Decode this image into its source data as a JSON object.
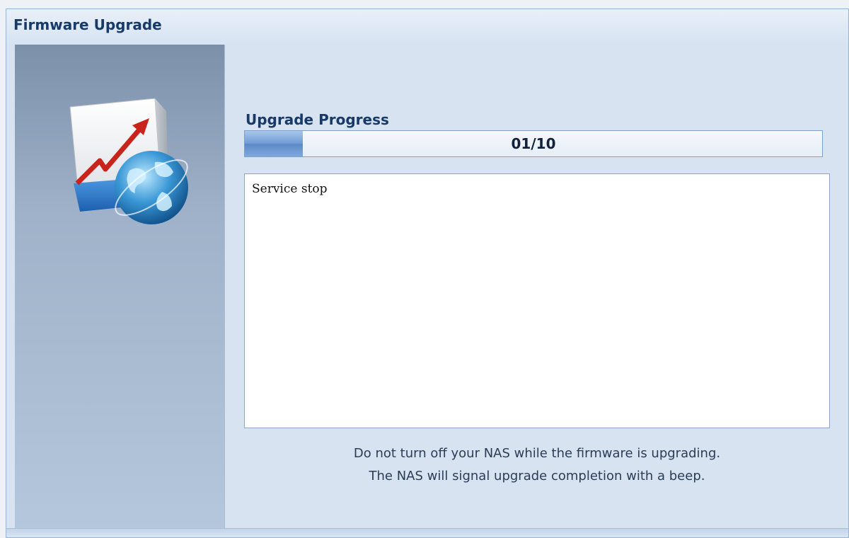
{
  "window": {
    "title": "Firmware Upgrade"
  },
  "progress": {
    "label": "Upgrade Progress",
    "text": "01/10",
    "fraction": 0.1
  },
  "log": {
    "lines": [
      "Service stop"
    ]
  },
  "notice": {
    "line1": "Do not turn off your NAS while the firmware is upgrading.",
    "line2": "The NAS will signal upgrade completion with a beep."
  },
  "icons": {
    "sidebar": "firmware-globe-icon"
  },
  "colors": {
    "accent": "#173a68",
    "progress_fill": "#6f9ad3"
  }
}
